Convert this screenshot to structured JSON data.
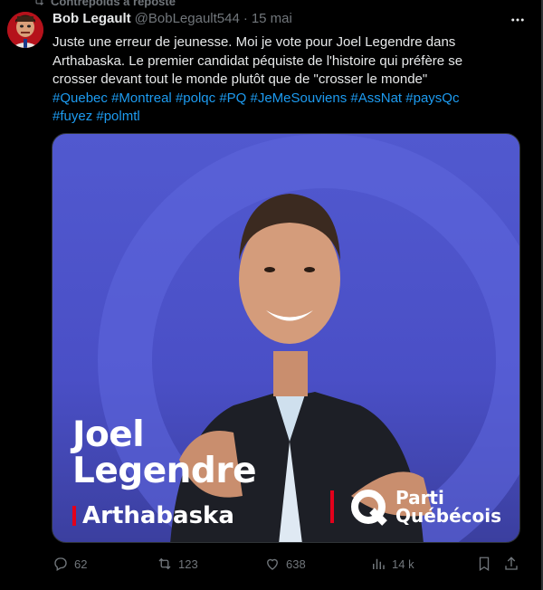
{
  "repost_label": "Contrepoids a reposté",
  "author": {
    "name": "Bob Legault",
    "handle": "@BobLegault544",
    "separator": "·",
    "date": "15 mai"
  },
  "tweet": {
    "lines": [
      "Juste une erreur de jeunesse.  Moi je vote pour Joel Legendre dans",
      "Arthabaska.  Le premier candidat péquiste de l'histoire qui préfère se",
      "crosser devant tout le monde plutôt que de \"crosser le monde\""
    ],
    "hashtags": [
      "#Quebec",
      "#Montreal",
      "#polqc",
      "#PQ",
      "#JeMeSouviens",
      "#AssNat",
      "#paysQc",
      "#fuyez",
      "#polmtl"
    ]
  },
  "media": {
    "first_name": "Joel",
    "last_name": "Legendre",
    "riding": "Arthabaska",
    "party_line1": "Parti",
    "party_line2": "Québécois"
  },
  "actions": {
    "replies": "62",
    "reposts": "123",
    "likes": "638",
    "views": "14 k"
  },
  "colors": {
    "background": "#000000",
    "text": "#e7e9ea",
    "muted": "#71767b",
    "link": "#1d9bf0",
    "media_blue": "#4a4fc6",
    "party_red": "#e3001b"
  }
}
